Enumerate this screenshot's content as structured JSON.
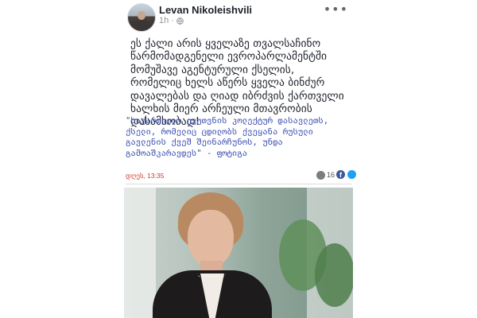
{
  "post": {
    "author": "Levan Nikoleishvili",
    "time": "1h",
    "visibility_icon": "globe-icon",
    "more_icon": "more-options-icon",
    "text": "ეს ქალი არის ყველაზე თვალსაჩინო წარმომადგენელი ევროპარლამენტში მომუშავე აგენტურული ქსელის, რომელიც ხელს აწერს ყველა ბინძურ დავალებას და ღიად იბრძვის ქართველი ხალხის მიერ არჩეული მთავრობის დასამხობად!",
    "more_label": "•••"
  },
  "shared": {
    "quote": "\"საქართველო ევუთვნის კოლექტურ დასავლეთს, ქსელი, რომელიც ცდილობს ქვეყანა რუსული გავლენის ქვეშ შეინარჩუნოს, უნდა გამოაშკარავდეს\" - ფოტიგა",
    "date": "დღეს, 13:35",
    "views": "16",
    "view_icon": "eye-icon",
    "facebook_icon": "facebook-share-icon",
    "facebook_glyph": "f",
    "twitter_icon": "twitter-share-icon"
  },
  "colors": {
    "author": "#1d2129",
    "quote": "#3b4db0",
    "date": "#d03a2e",
    "facebook": "#3b5998",
    "twitter": "#1da1f2"
  }
}
